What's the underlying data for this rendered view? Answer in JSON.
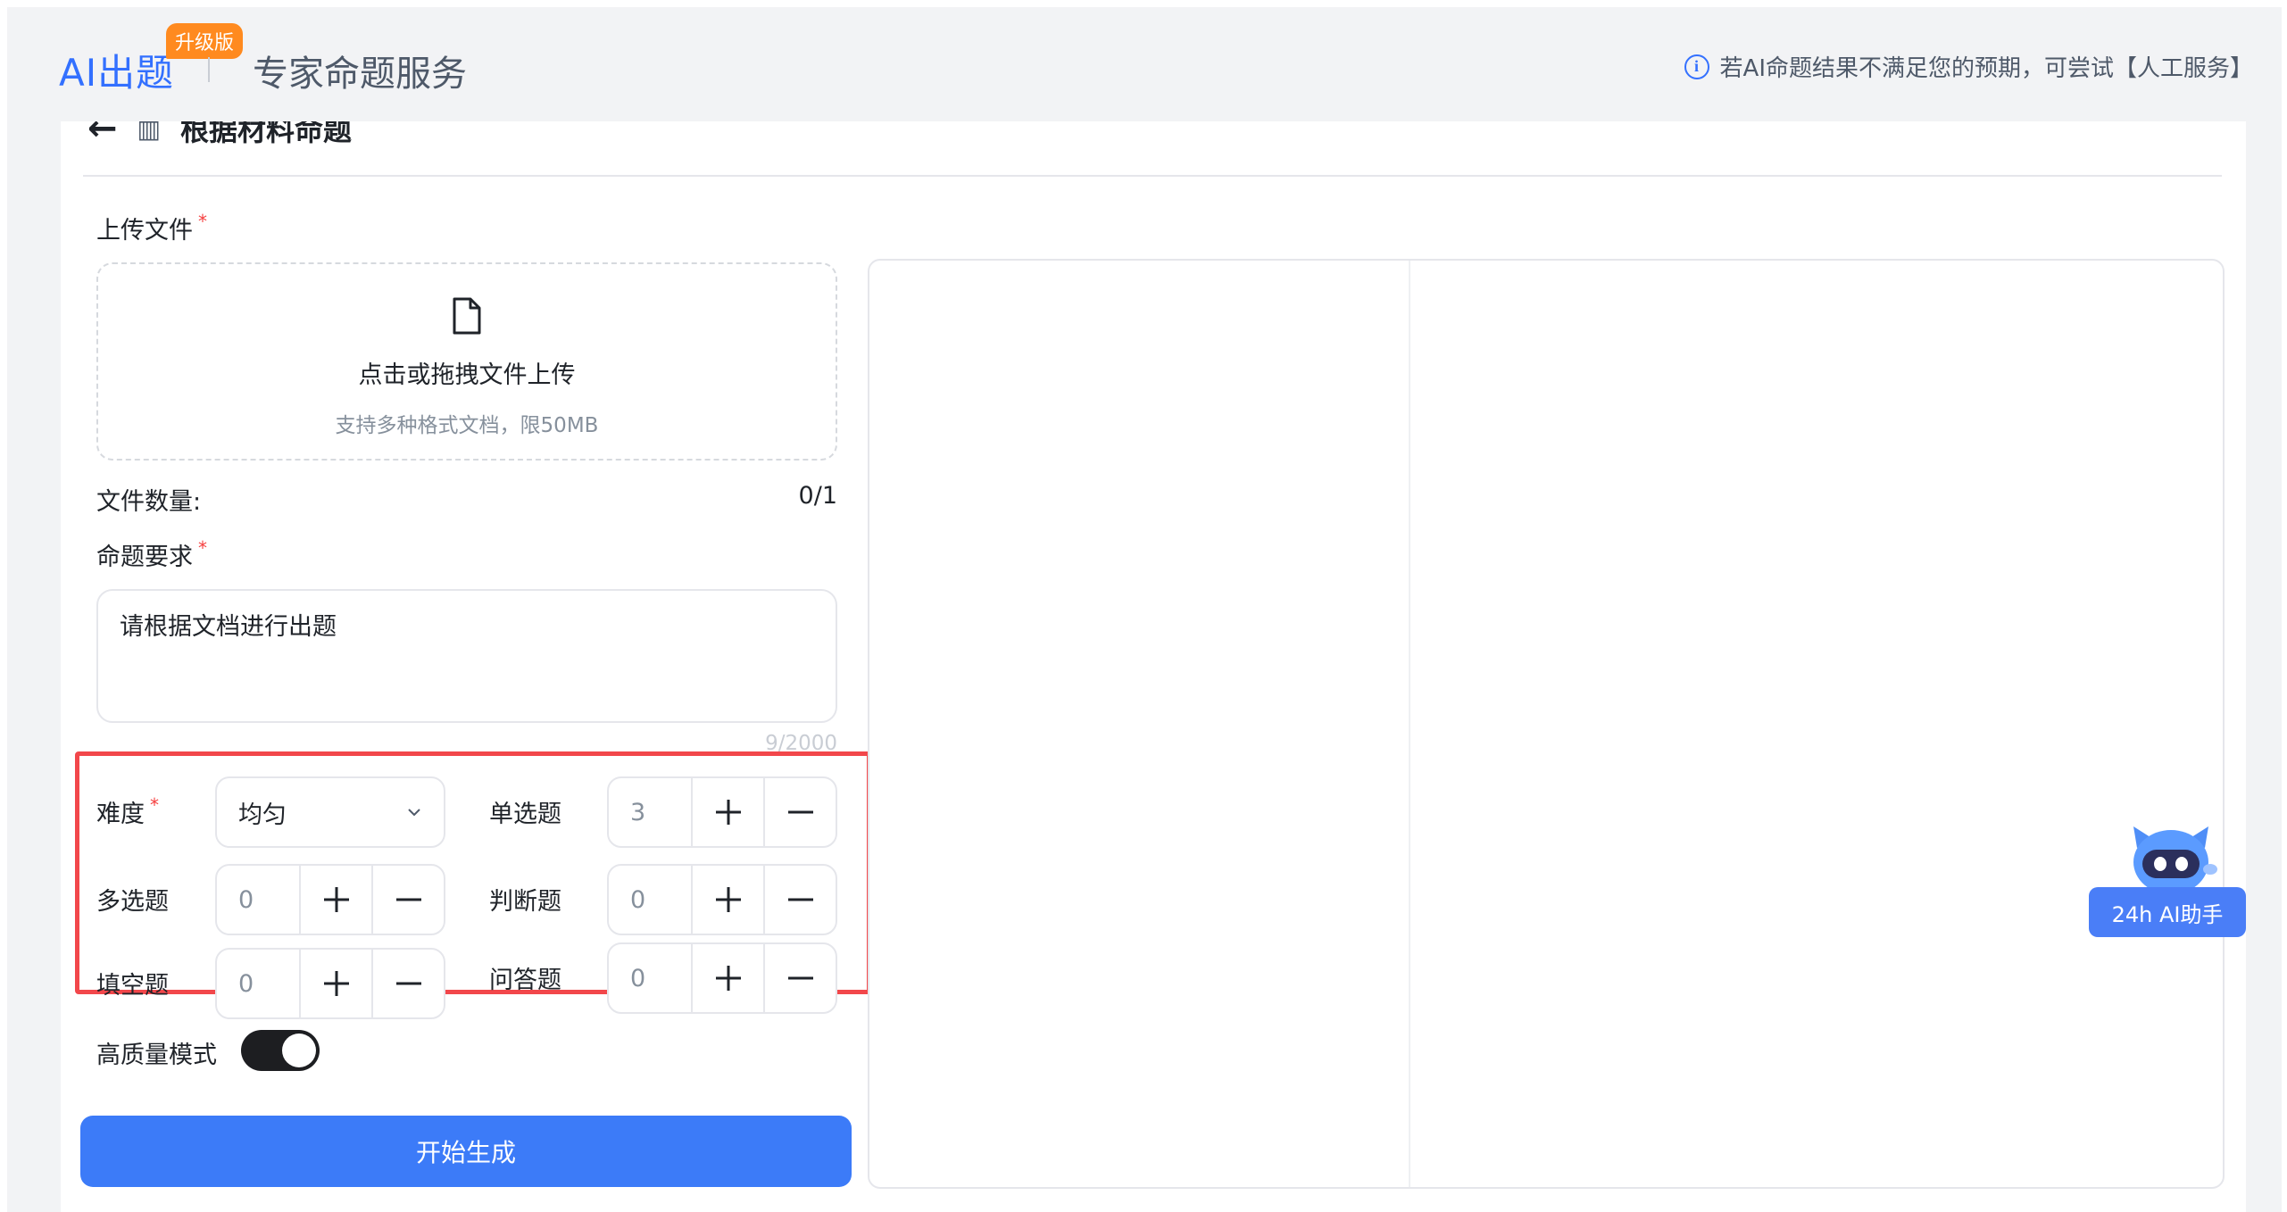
{
  "header": {
    "brand": "AI出题",
    "badge": "升级版",
    "service_title": "专家命题服务",
    "notice": "若AI命题结果不满足您的预期，可尝试【人工服务】"
  },
  "subhead": {
    "title": "根据材料命题"
  },
  "upload": {
    "label": "上传文件",
    "required_mark": "*",
    "title": "点击或拖拽文件上传",
    "hint": "支持多种格式文档，限50MB",
    "count_label": "文件数量:",
    "count_value": "0/1"
  },
  "requirement": {
    "label": "命题要求",
    "required_mark": "*",
    "value": "请根据文档进行出题",
    "char_count": "9/2000"
  },
  "options": {
    "difficulty_label": "难度",
    "difficulty_required": "*",
    "difficulty_value": "均匀",
    "single_choice_label": "单选题",
    "single_choice_value": "3",
    "multi_choice_label": "多选题",
    "multi_choice_value": "0",
    "true_false_label": "判断题",
    "true_false_value": "0",
    "fill_blank_label": "填空题",
    "fill_blank_value": "0",
    "qa_label": "问答题",
    "qa_value": "0"
  },
  "high_quality": {
    "label": "高质量模式",
    "enabled": true
  },
  "generate_button": "开始生成",
  "assistant": {
    "label": "24h AI助手"
  },
  "colors": {
    "accent": "#3370ff",
    "button": "#3c7bf8",
    "badge": "#ff8a1f",
    "highlight_border": "#f2474b",
    "toggle_on": "#1d1e21"
  },
  "icons": [
    "back-arrow-icon",
    "book-icon",
    "file-icon",
    "chevron-down-icon",
    "plus-icon",
    "minus-icon",
    "info-icon",
    "robot-icon"
  ]
}
